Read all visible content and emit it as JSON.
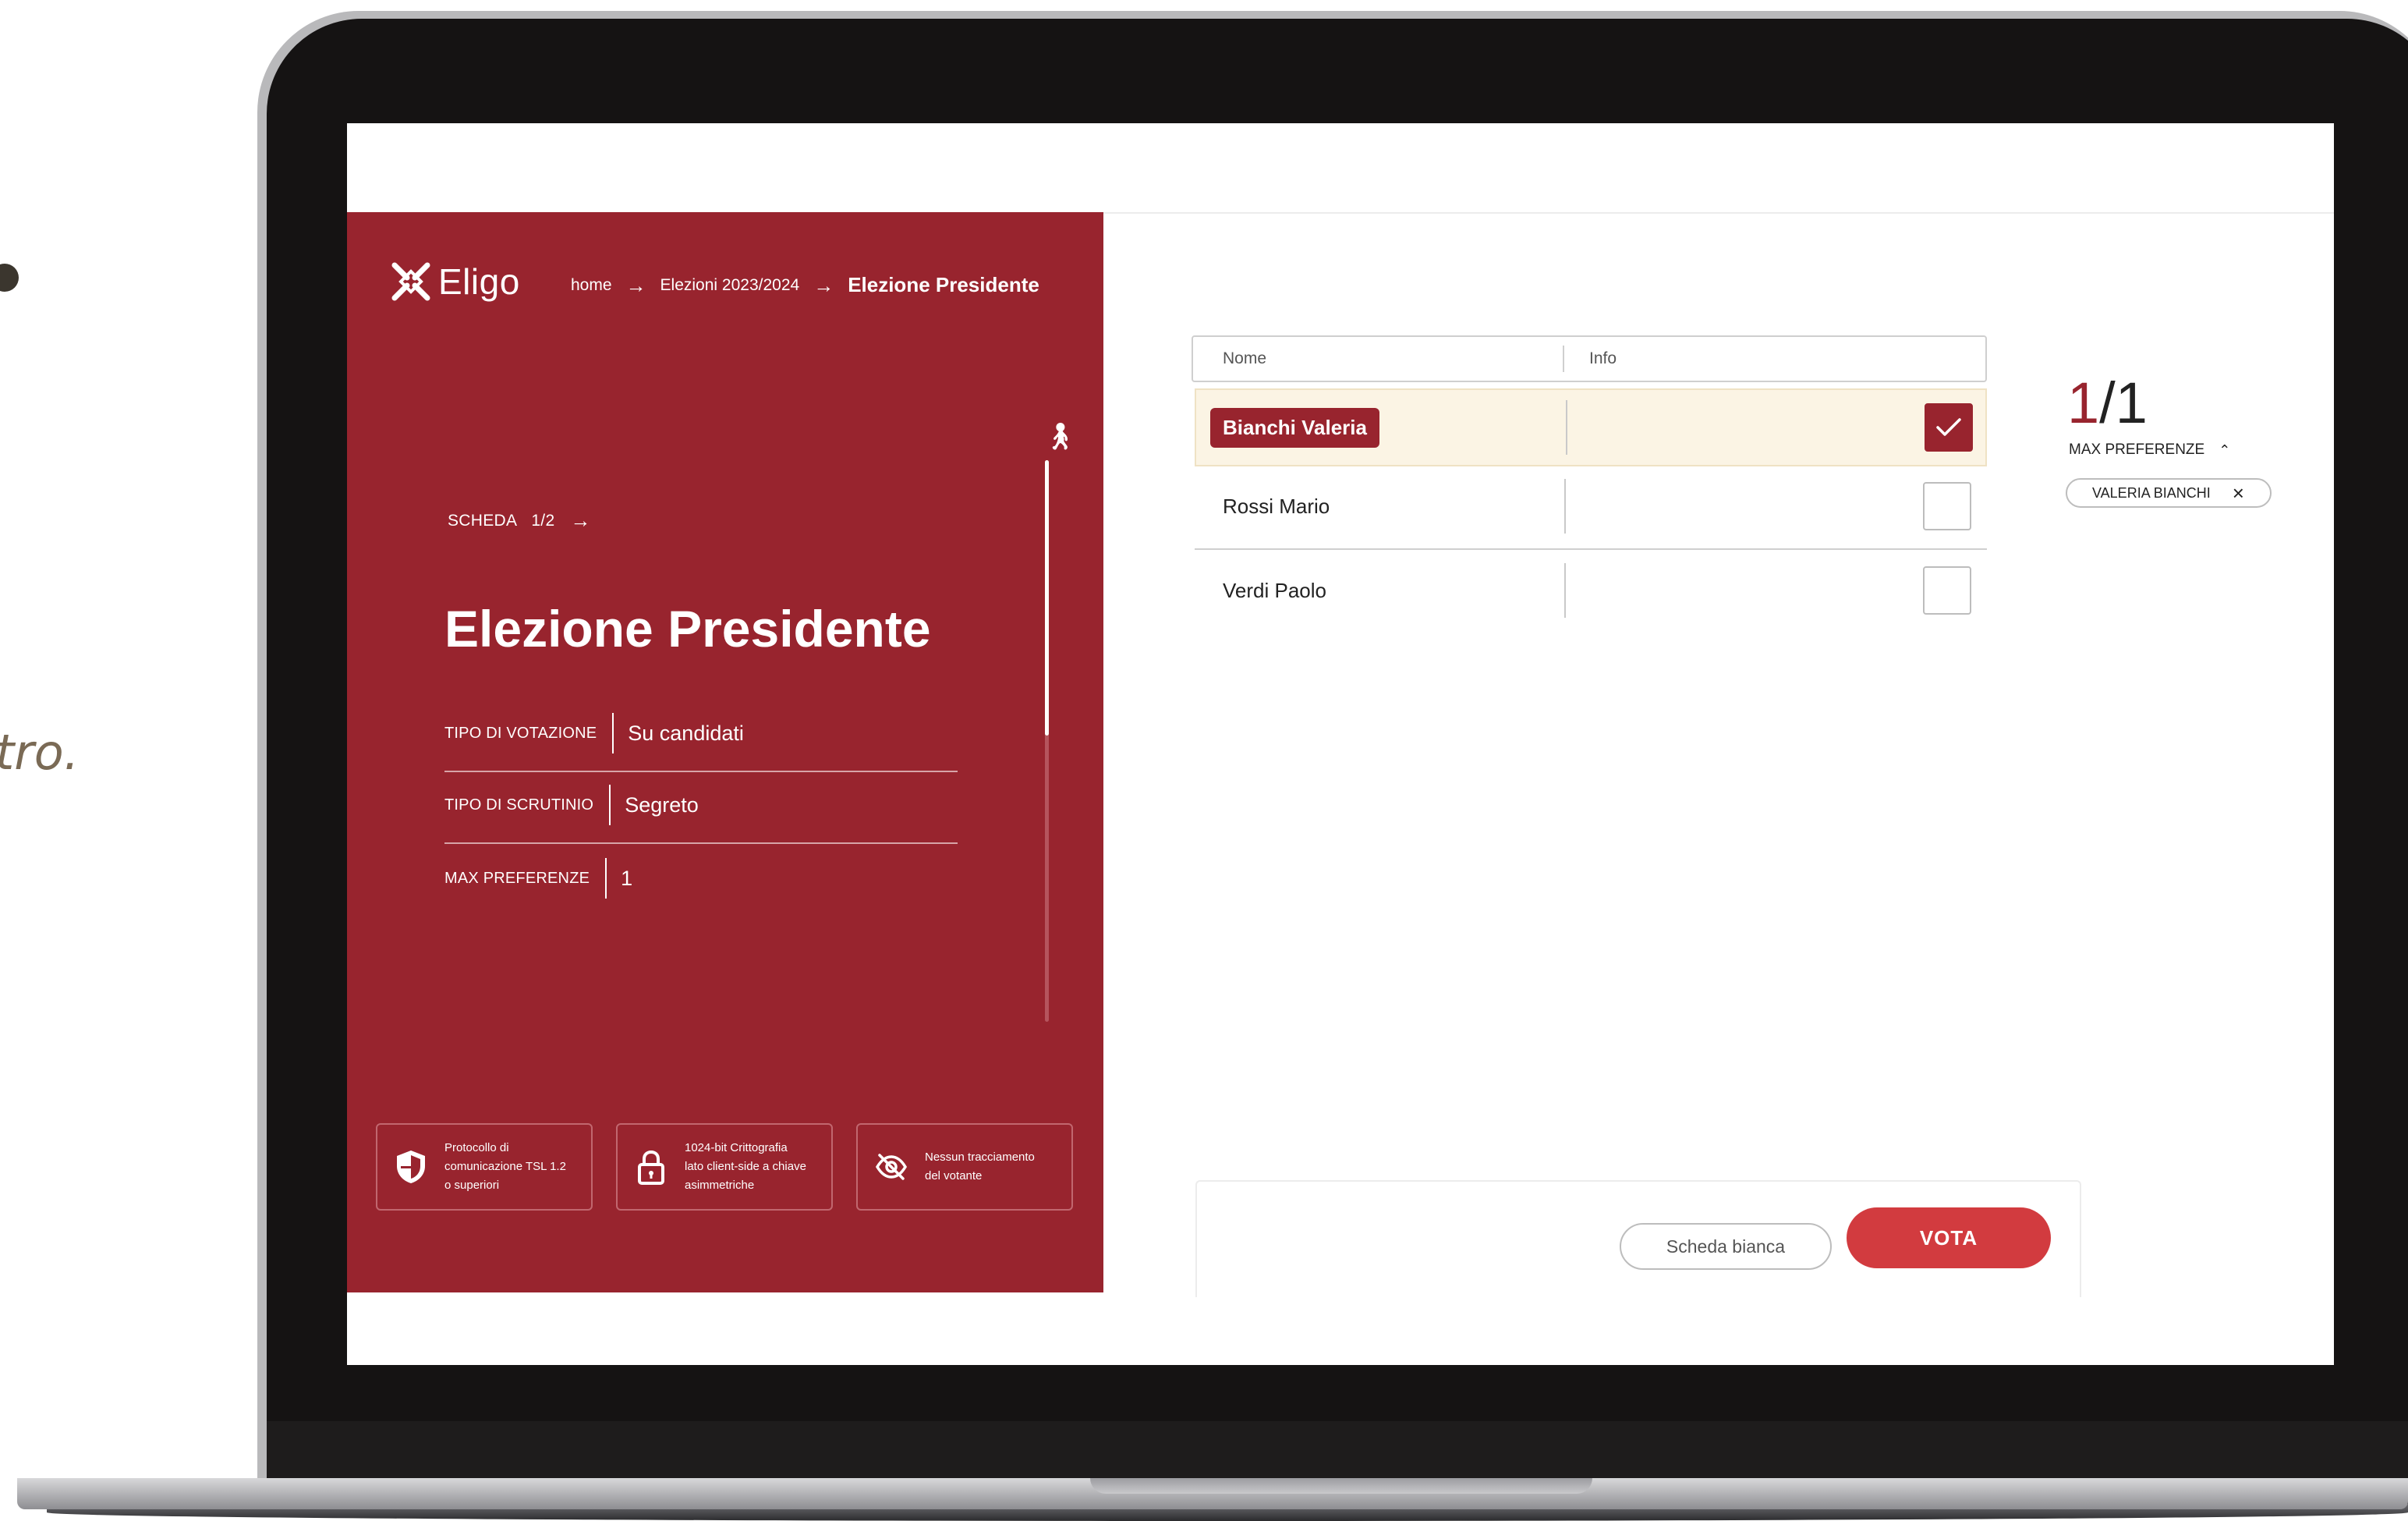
{
  "background": {
    "text": "tro."
  },
  "app": {
    "logo_text": "Eligo",
    "breadcrumb": [
      "home",
      "Elezioni 2023/2024",
      "Elezione Presidente"
    ]
  },
  "ballot": {
    "scheda_label": "SCHEDA",
    "scheda_num": "1/2",
    "title": "Elezione Presidente",
    "info": [
      {
        "label": "TIPO DI VOTAZIONE",
        "value": "Su candidati"
      },
      {
        "label": "TIPO DI SCRUTINIO",
        "value": "Segreto"
      },
      {
        "label": "MAX PREFERENZE",
        "value": "1"
      }
    ],
    "scroll_progress": 0.49
  },
  "security": [
    {
      "icon": "shield-icon",
      "text": "Protocollo di comunicazione TSL 1.2 o superiori"
    },
    {
      "icon": "lock-icon",
      "text": "1024-bit Crittografia lato client-side a chiave asimmetriche"
    },
    {
      "icon": "eye-off-icon",
      "text": "Nessun tracciamento del votante"
    }
  ],
  "table": {
    "headers": {
      "name": "Nome",
      "info": "Info"
    },
    "candidates": [
      {
        "name": "Bianchi Valeria",
        "selected": true
      },
      {
        "name": "Rossi Mario",
        "selected": false
      },
      {
        "name": "Verdi Paolo",
        "selected": false
      }
    ]
  },
  "preferences": {
    "current": "1",
    "max": "1",
    "label": "MAX PREFERENZE",
    "chip": "VALERIA BIANCHI"
  },
  "actions": {
    "blank_label": "Scheda bianca",
    "vote_label": "VOTA"
  },
  "colors": {
    "brand": "#98242e",
    "vote": "#d23b3f",
    "selected_row": "#fbf4e4"
  }
}
